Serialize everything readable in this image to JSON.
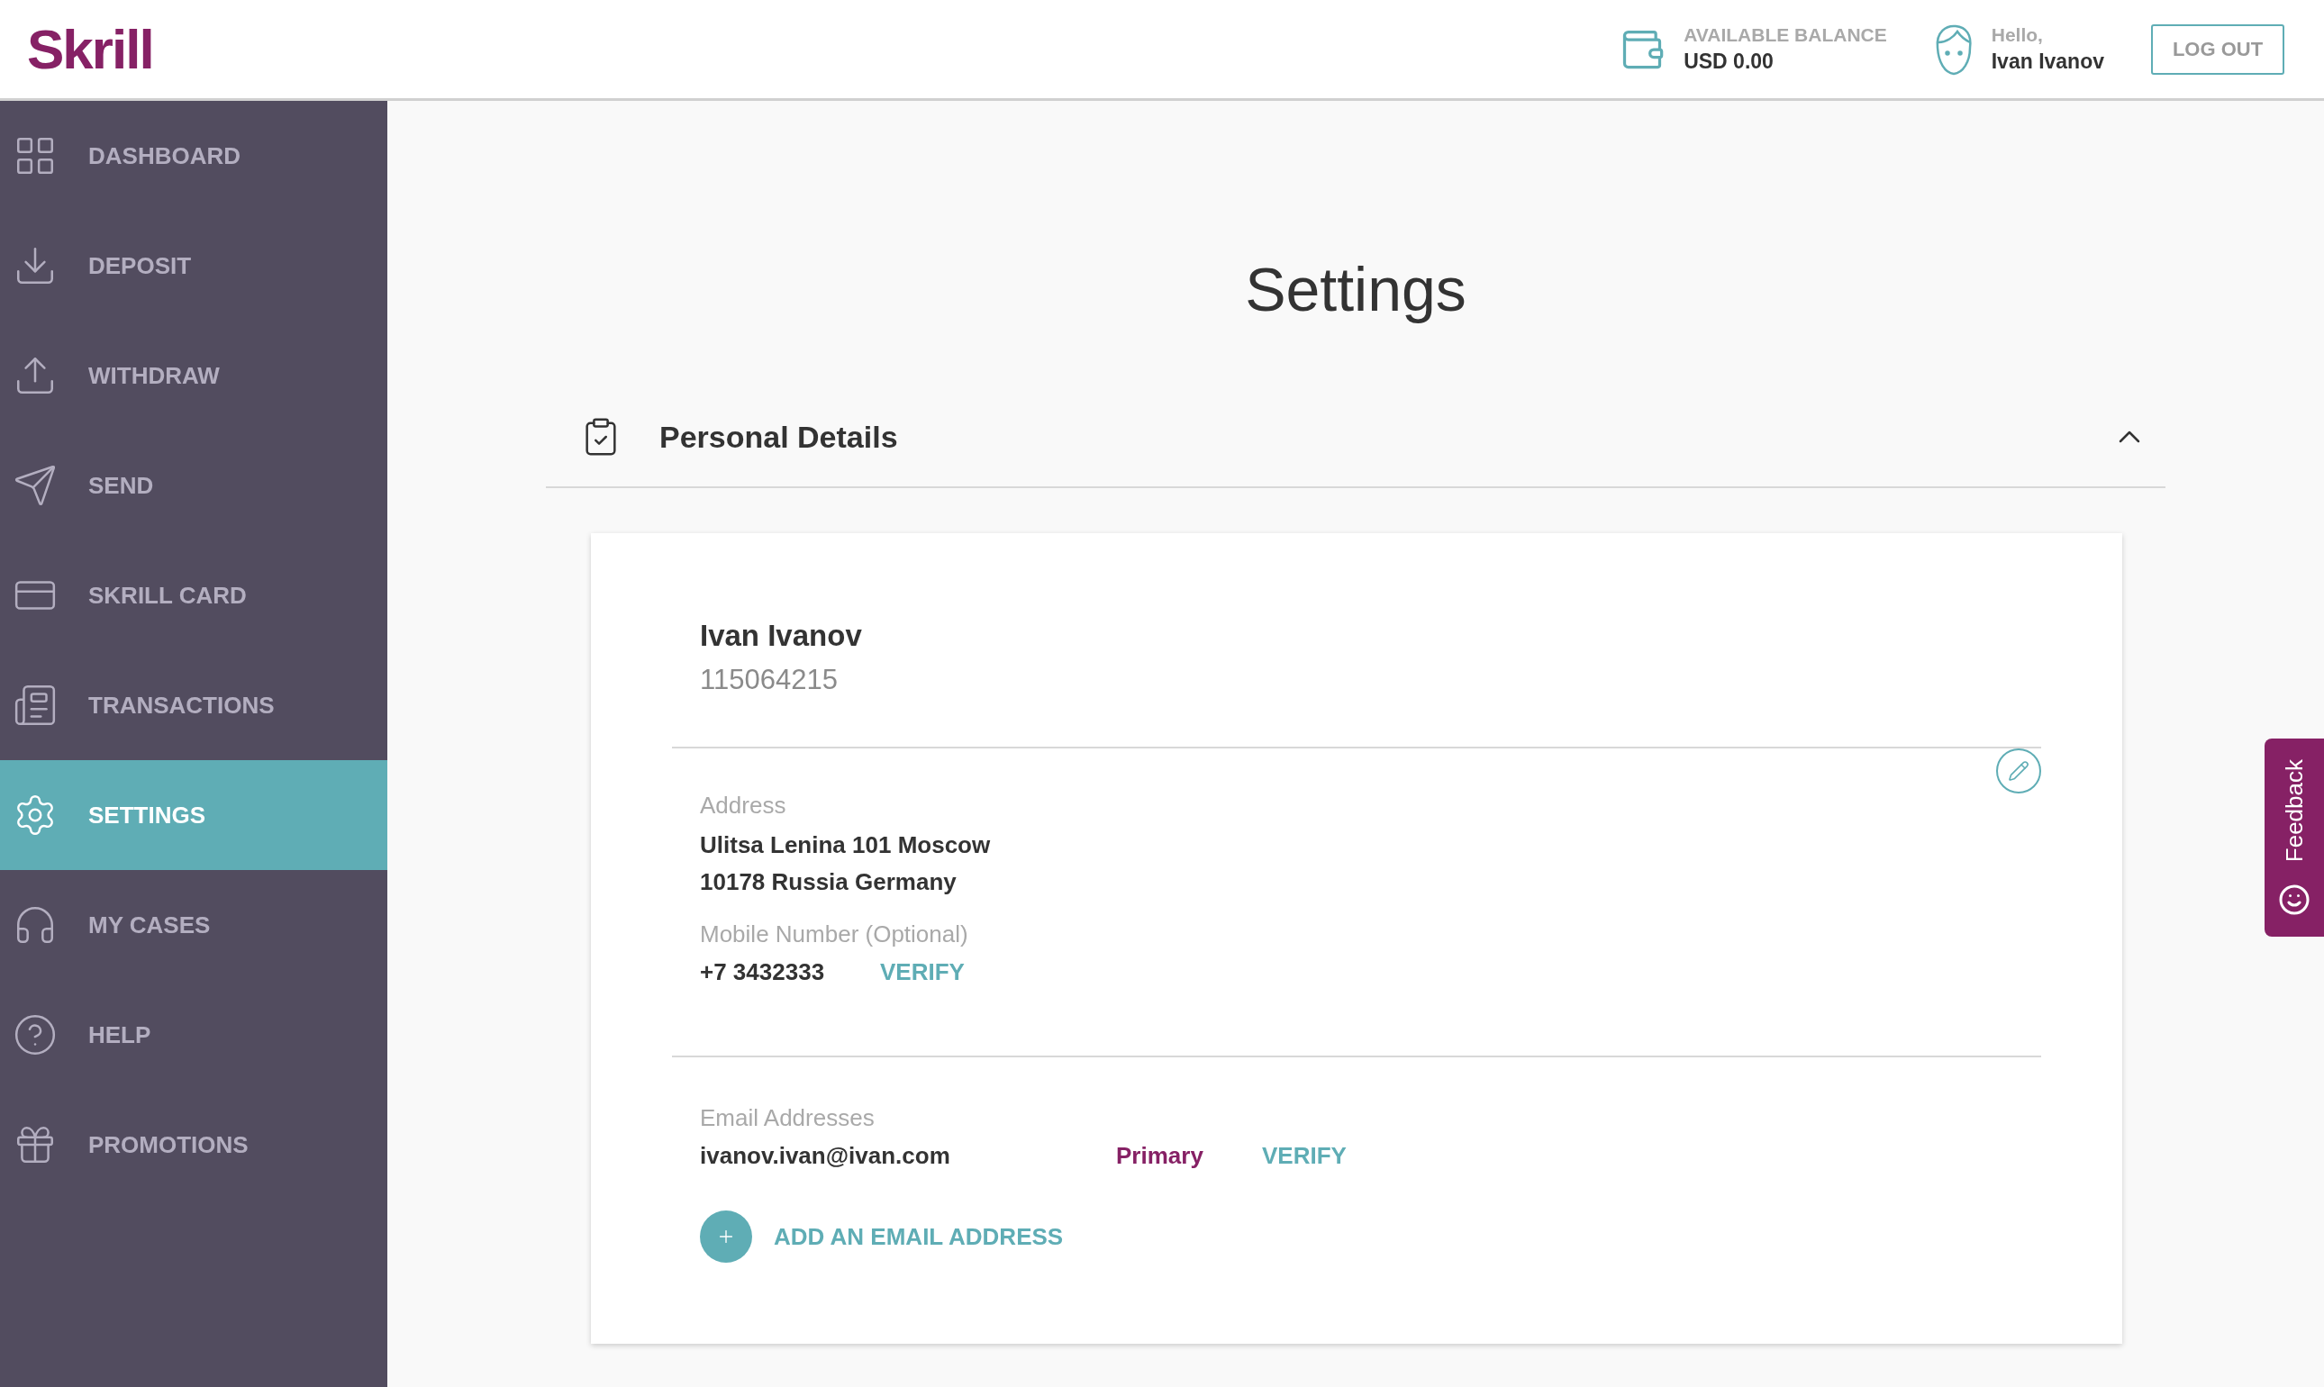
{
  "header": {
    "logo": "Skrill",
    "balance_label": "AVAILABLE BALANCE",
    "balance_value": "USD 0.00",
    "greeting": "Hello,",
    "user_name": "Ivan Ivanov",
    "logout": "LOG OUT"
  },
  "sidebar": {
    "items": [
      {
        "label": "DASHBOARD",
        "selected": false
      },
      {
        "label": "DEPOSIT",
        "selected": false
      },
      {
        "label": "WITHDRAW",
        "selected": false
      },
      {
        "label": "SEND",
        "selected": false
      },
      {
        "label": "SKRILL CARD",
        "selected": false
      },
      {
        "label": "TRANSACTIONS",
        "selected": false
      },
      {
        "label": "SETTINGS",
        "selected": true
      },
      {
        "label": "MY CASES",
        "selected": false
      },
      {
        "label": "HELP",
        "selected": false
      },
      {
        "label": "PROMOTIONS",
        "selected": false
      }
    ]
  },
  "page_title": "Settings",
  "section": {
    "title": "Personal Details",
    "expanded": true
  },
  "card": {
    "name": "Ivan Ivanov",
    "customer_id": "115064215",
    "address_label": "Address",
    "address_lines": [
      "Ulitsa Lenina 101 Moscow",
      "10178 Russia Germany"
    ],
    "mobile_label": "Mobile Number (Optional)",
    "mobile": "+7 3432333",
    "mobile_action": "VERIFY",
    "email_label": "Email Addresses",
    "emails": [
      {
        "address": "ivanov.ivan@ivan.com",
        "tag": "Primary",
        "action": "VERIFY"
      }
    ],
    "add_email": "ADD AN EMAIL ADDRESS"
  },
  "feedback": {
    "label": "Feedback"
  }
}
